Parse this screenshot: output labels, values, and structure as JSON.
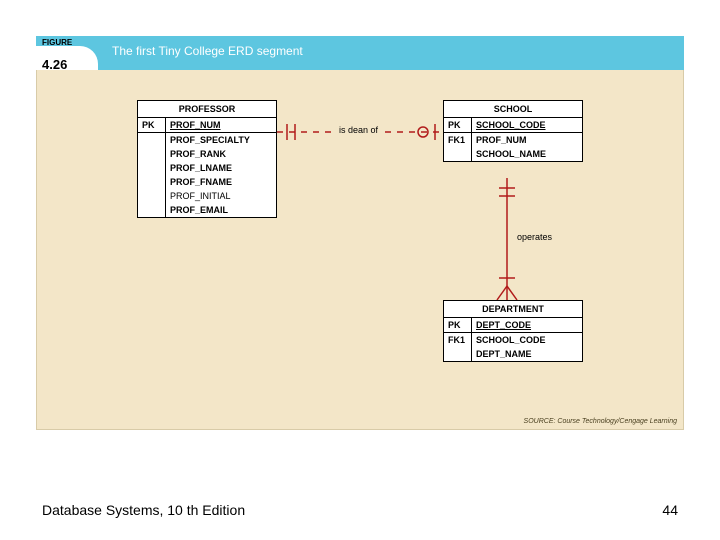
{
  "figure": {
    "label": "FIGURE",
    "number": "4.26",
    "title": "The first Tiny College ERD segment"
  },
  "entities": {
    "professor": {
      "name": "PROFESSOR",
      "pk_label": "PK",
      "pk_field": "PROF_NUM",
      "attrs": [
        "PROF_SPECIALTY",
        "PROF_RANK",
        "PROF_LNAME",
        "PROF_FNAME",
        "PROF_INITIAL",
        "PROF_EMAIL"
      ]
    },
    "school": {
      "name": "SCHOOL",
      "pk_label": "PK",
      "pk_field": "SCHOOL_CODE",
      "fk_label": "FK1",
      "fk_field": "PROF_NUM",
      "attr2": "SCHOOL_NAME"
    },
    "department": {
      "name": "DEPARTMENT",
      "pk_label": "PK",
      "pk_field": "DEPT_CODE",
      "fk_label": "FK1",
      "fk_field": "SCHOOL_CODE",
      "attr2": "DEPT_NAME"
    }
  },
  "rel": {
    "dean": "is dean of",
    "operates": "operates"
  },
  "source": "SOURCE: Course Technology/Cengage Learning",
  "footer": {
    "book": "Database Systems, 10 th Edition",
    "page": "44"
  }
}
